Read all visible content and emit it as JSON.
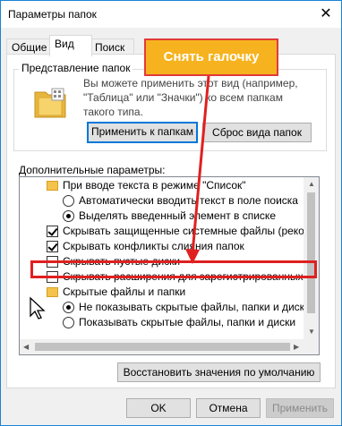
{
  "window": {
    "title": "Параметры папок",
    "close_glyph": "✕"
  },
  "tabs": [
    {
      "label": "Общие"
    },
    {
      "label": "Вид",
      "active": true
    },
    {
      "label": "Поиск"
    }
  ],
  "folder_view": {
    "group_label": "Представление папок",
    "description": "Вы можете применить этот вид (например, \"Таблица\" или \"Значки\") ко всем папкам такого типа.",
    "apply_button": "Применить к папкам",
    "reset_button": "Сброс вида папок"
  },
  "advanced": {
    "label": "Дополнительные параметры:",
    "items": [
      {
        "kind": "folder",
        "label": "При вводе текста в режиме \"Список\""
      },
      {
        "kind": "radio",
        "checked": false,
        "label": "Автоматически вводить текст в поле поиска"
      },
      {
        "kind": "radio",
        "checked": true,
        "label": "Выделять введенный элемент в списке"
      },
      {
        "kind": "check",
        "checked": true,
        "label": "Скрывать защищенные системные файлы (рекомен"
      },
      {
        "kind": "check",
        "checked": true,
        "label": "Скрывать конфликты слияния папок"
      },
      {
        "kind": "check",
        "checked": false,
        "label": "Скрывать пустые диски"
      },
      {
        "kind": "check",
        "checked": false,
        "label": "Скрывать расширения для зарегистрированных типо"
      },
      {
        "kind": "folder",
        "label": "Скрытые файлы и папки"
      },
      {
        "kind": "radio",
        "checked": true,
        "label": "Не показывать скрытые файлы, папки и диски"
      },
      {
        "kind": "radio",
        "checked": false,
        "label": "Показывать скрытые файлы, папки и диски"
      }
    ],
    "restore_button": "Восстановить значения по умолчанию"
  },
  "footer": {
    "ok": "OK",
    "cancel": "Отмена",
    "apply": "Применить"
  },
  "annotation": {
    "callout_text": "Снять галочку",
    "callout_color": "#f6b31f",
    "border_color": "#e23a3a"
  }
}
